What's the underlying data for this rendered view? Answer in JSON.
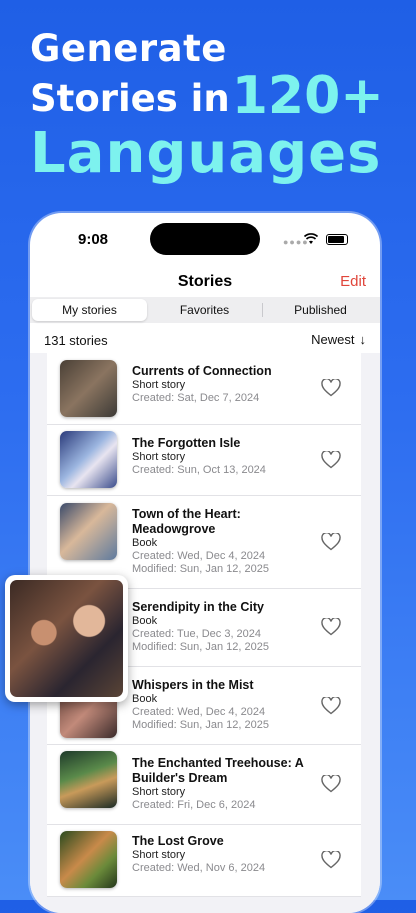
{
  "headline": {
    "line1": "Generate",
    "line2_text": "Stories in",
    "line2_accent": "120+",
    "line3": "Languages"
  },
  "status_bar": {
    "time": "9:08"
  },
  "nav": {
    "title": "Stories",
    "edit_label": "Edit"
  },
  "tabs": [
    {
      "label": "My stories",
      "active": true
    },
    {
      "label": "Favorites",
      "active": false
    },
    {
      "label": "Published",
      "active": false
    }
  ],
  "list_header": {
    "count": "131 stories",
    "sort_label": "Newest",
    "sort_icon": "arrow-down-icon"
  },
  "stories": [
    {
      "title": "Currents of Connection",
      "type": "Short story",
      "created": "Created: Sat, Dec 7, 2024",
      "modified": ""
    },
    {
      "title": "The Forgotten Isle",
      "type": "Short story",
      "created": "Created: Sun, Oct 13, 2024",
      "modified": ""
    },
    {
      "title": "Town of the Heart: Meadowgrove",
      "type": "Book",
      "created": "Created: Wed, Dec 4, 2024",
      "modified": "Modified: Sun, Jan 12, 2025"
    },
    {
      "title": "Serendipity in the City",
      "type": "Book",
      "created": "Created: Tue, Dec 3, 2024",
      "modified": "Modified: Sun, Jan 12, 2025"
    },
    {
      "title": "Whispers in the Mist",
      "type": "Book",
      "created": "Created: Wed, Dec 4, 2024",
      "modified": "Modified: Sun, Jan 12, 2025"
    },
    {
      "title": "The Enchanted Treehouse: A Builder's Dream",
      "type": "Short story",
      "created": "Created: Fri, Dec 6, 2024",
      "modified": ""
    },
    {
      "title": "The Lost Grove",
      "type": "Short story",
      "created": "Created: Wed, Nov 6, 2024",
      "modified": ""
    }
  ],
  "colors": {
    "accent": "#e0453a",
    "headline_accent": "#7df2ee",
    "background": "#2d6df0"
  }
}
